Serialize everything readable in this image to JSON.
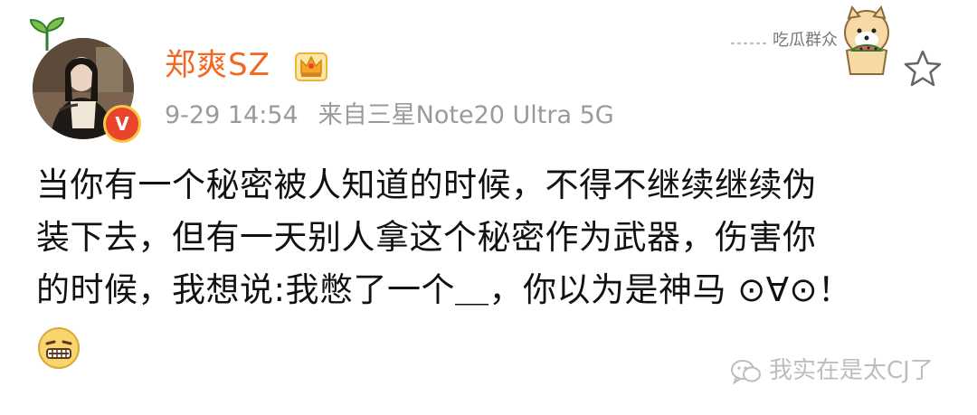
{
  "post": {
    "username": "郑爽SZ",
    "timestamp": "9-29 14:54",
    "source": "来自三星Note20 Ultra 5G",
    "content_lines": [
      "当你有一个秘密被人知道的时候，不得不继续继续伪",
      "装下去，但有一天别人拿这个秘密作为武器，伤害你",
      "的时候，我想说:我憋了一个＿，你以为是神马 ⊙∀⊙！"
    ]
  },
  "sticker": {
    "text": "吃瓜群众"
  },
  "watermark": {
    "text": "我实在是太CJ了"
  },
  "icons": {
    "verified": "verified-v-badge-icon",
    "member": "member-crown-badge-icon",
    "favorite": "star-outline-icon",
    "emoji": "zipped-mouth-emoji-icon",
    "wechat": "wechat-icon",
    "sprout": "sprout-decoration-icon"
  },
  "colors": {
    "username": "#f26722",
    "meta": "#9a9a9a",
    "content": "#111111",
    "verified_badge": "#e8452c",
    "watermark": "#bdbdbd"
  }
}
